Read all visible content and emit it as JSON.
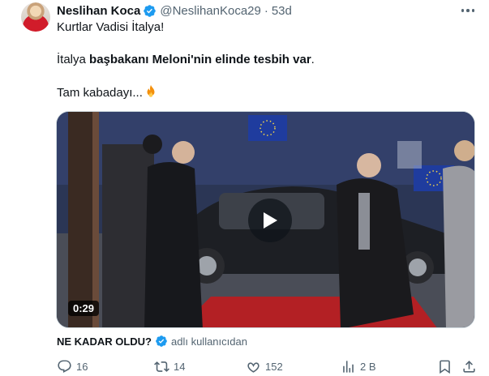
{
  "tweet": {
    "author_name": "Neslihan Koca",
    "handle": "@NeslihanKoca29",
    "separator": "·",
    "time": "53d",
    "line1": "Kurtlar Vadisi İtalya!",
    "line2_prefix": "İtalya ",
    "line2_bold": "başbakanı Meloni'nin elinde tesbih var",
    "line2_suffix": ".",
    "line3": "Tam kabadayı..."
  },
  "media": {
    "duration": "0:29"
  },
  "quote": {
    "name": "NE KADAR OLDU?",
    "subtitle": "adlı kullanıcıdan"
  },
  "actions": {
    "replies": "16",
    "reposts": "14",
    "likes": "152",
    "views": "2 B"
  },
  "colors": {
    "verified": "#1d9bf0",
    "secondary_text": "#536471",
    "primary_text": "#0f1419"
  },
  "icons": [
    "verified-badge-icon",
    "more-icon",
    "fire-emoji-icon",
    "play-icon",
    "reply-icon",
    "repost-icon",
    "like-icon",
    "views-icon",
    "bookmark-icon",
    "share-icon"
  ]
}
